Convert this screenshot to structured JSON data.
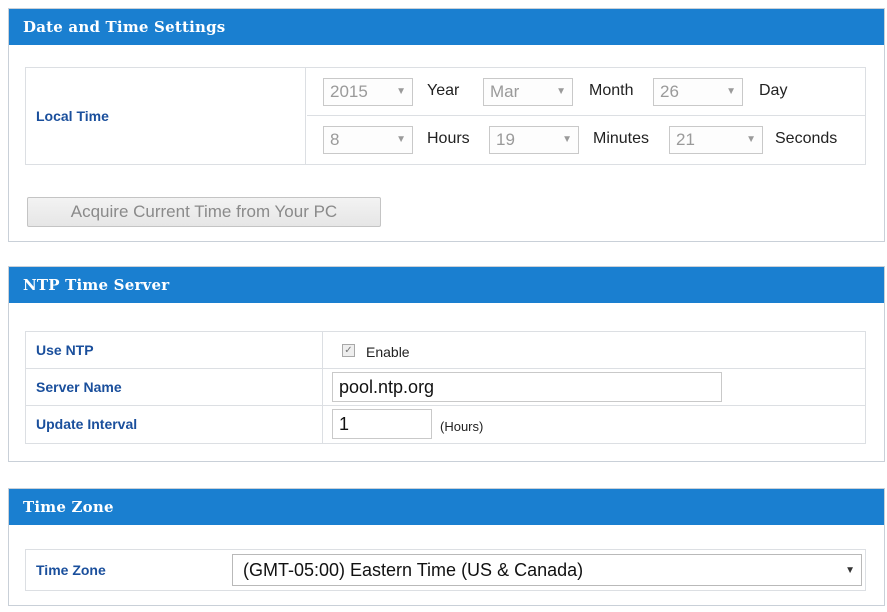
{
  "datetime": {
    "header": "Date and Time Settings",
    "local_time_label": "Local Time",
    "year": {
      "value": "2015",
      "unit": "Year"
    },
    "month": {
      "value": "Mar",
      "unit": "Month"
    },
    "day": {
      "value": "26",
      "unit": "Day"
    },
    "hours": {
      "value": "8",
      "unit": "Hours"
    },
    "minutes": {
      "value": "19",
      "unit": "Minutes"
    },
    "seconds": {
      "value": "21",
      "unit": "Seconds"
    },
    "acquire_button": "Acquire Current Time from Your PC"
  },
  "ntp": {
    "header": "NTP Time Server",
    "use_ntp_label": "Use NTP",
    "enable_label": "Enable",
    "enable_checked": true,
    "server_name_label": "Server Name",
    "server_name_value": "pool.ntp.org",
    "update_interval_label": "Update Interval",
    "update_interval_value": "1",
    "update_interval_unit": "(Hours)"
  },
  "timezone": {
    "header": "Time Zone",
    "label": "Time Zone",
    "selected": "(GMT-05:00) Eastern Time (US & Canada)"
  },
  "colors": {
    "header_bg": "#1a7fd0",
    "label": "#1a4f9c"
  }
}
